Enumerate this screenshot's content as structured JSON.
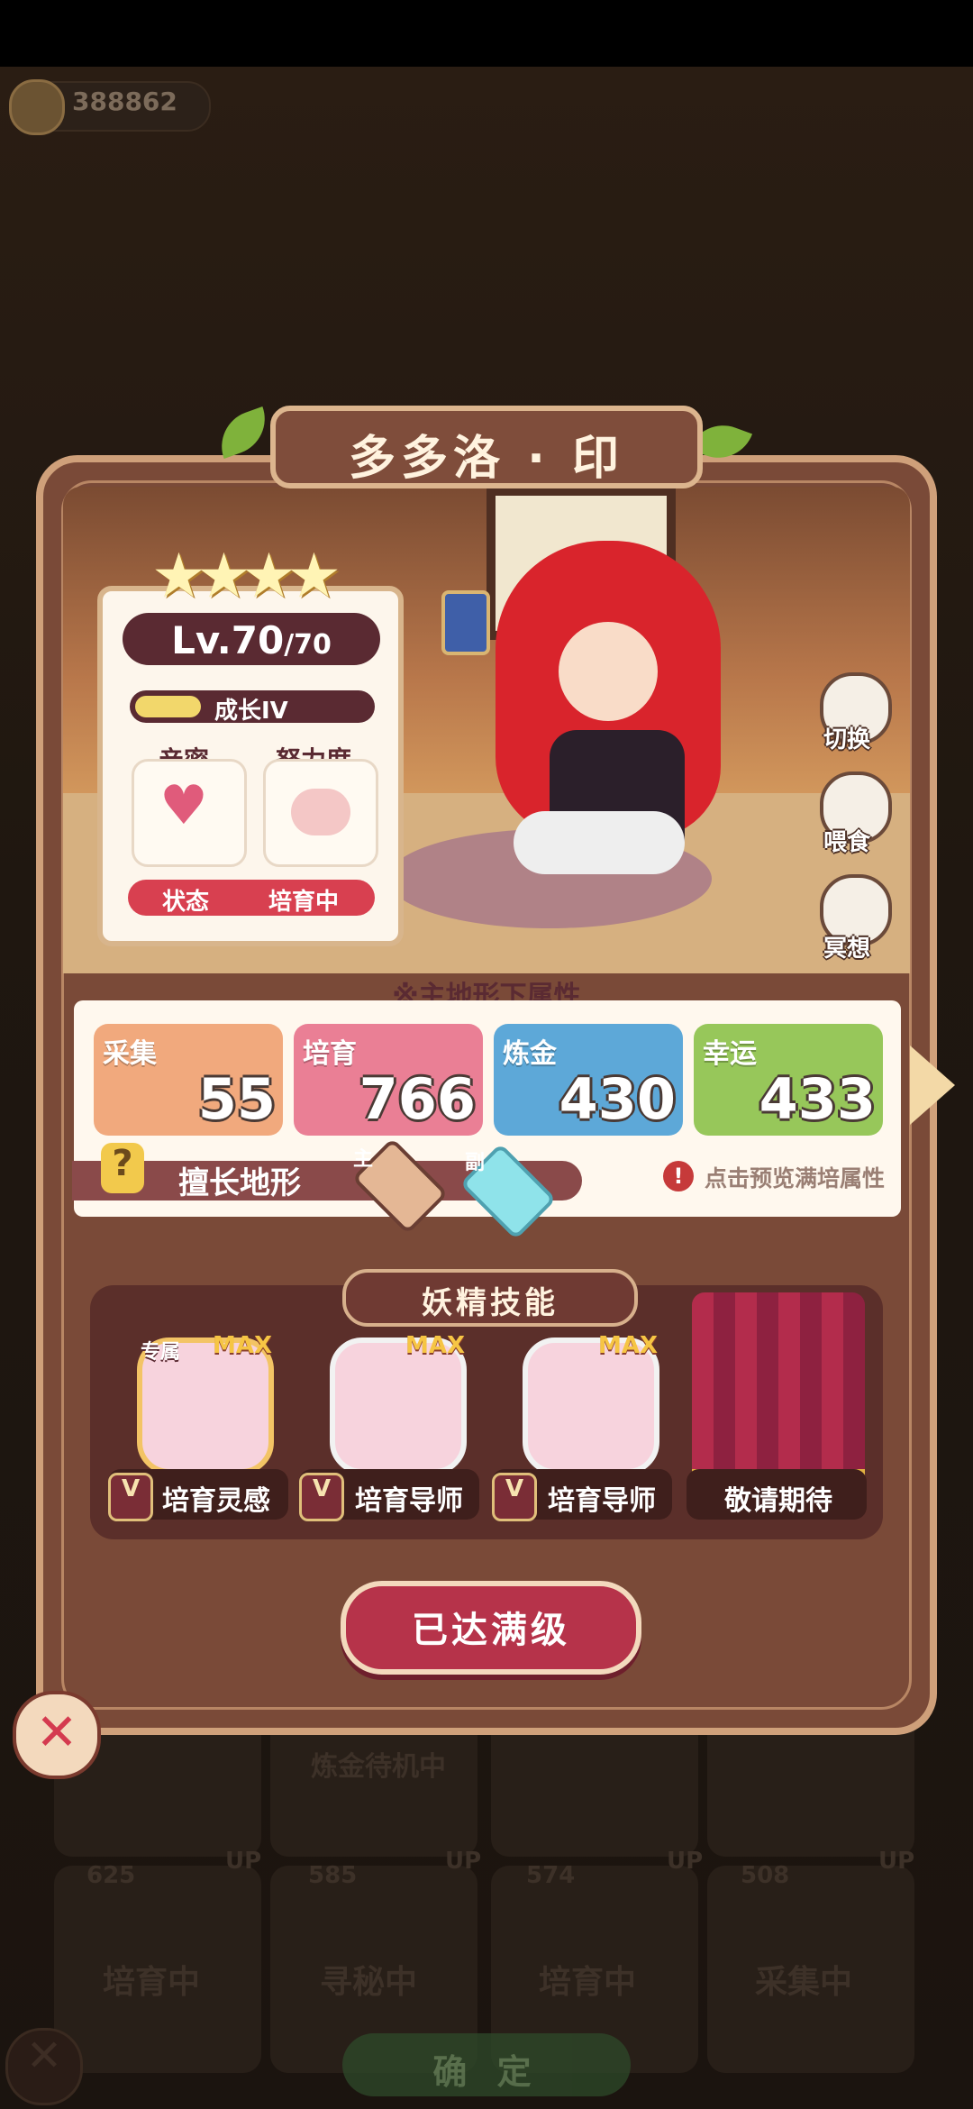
{
  "currency": {
    "amount": "388862",
    "icon": "coin-icon"
  },
  "character": {
    "name": "多多洛 · 印",
    "stars": 4,
    "level_text": "Lv.70",
    "level_max": "/70",
    "growth_label": "成长IV",
    "growth_fill": 0.28,
    "affinity_label": "亲密",
    "effort_label": "努力度",
    "status_label": "状态",
    "status_value": "培育中"
  },
  "side_actions": [
    {
      "label": "切换",
      "icon": "switch-icon"
    },
    {
      "label": "喂食",
      "icon": "meat-icon"
    },
    {
      "label": "冥想",
      "icon": "meditate-icon"
    }
  ],
  "stats_header": "※主地形下属性",
  "stats": [
    {
      "label": "采集",
      "value": "55",
      "color": "#f1a97d"
    },
    {
      "label": "培育",
      "value": "766",
      "color": "#ea7f95"
    },
    {
      "label": "炼金",
      "value": "430",
      "color": "#5da8d8"
    },
    {
      "label": "幸运",
      "value": "433",
      "color": "#97c75a"
    }
  ],
  "terrain": {
    "label": "擅长地形",
    "primary_tag": "主",
    "secondary_tag": "副",
    "preview_text": "点击预览满培属性"
  },
  "skills": {
    "title": "妖精技能",
    "exclusive_tag": "专属",
    "items": [
      {
        "name": "培育灵感",
        "max": "MAX",
        "v": "V"
      },
      {
        "name": "培育导师",
        "max": "MAX",
        "v": "V"
      },
      {
        "name": "培育导师",
        "max": "MAX",
        "v": "V"
      },
      {
        "name": "敬请期待"
      }
    ]
  },
  "maxed_button": "已达满级",
  "background": {
    "dim_labels": [
      "炼金待机中",
      "培育中",
      "寻秘中",
      "培育中",
      "采集中",
      "培育中"
    ],
    "dim_numbers": [
      "625",
      "585",
      "574",
      "508"
    ],
    "up_tag": "UP"
  },
  "confirm_button": "确 定"
}
